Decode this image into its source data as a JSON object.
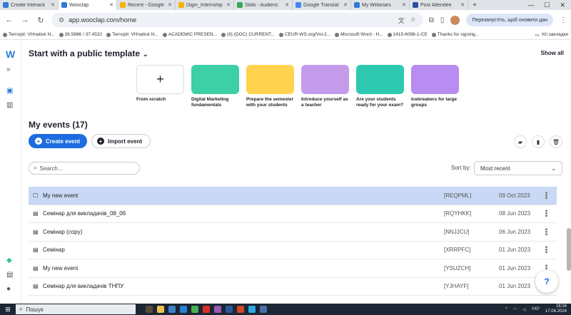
{
  "browser": {
    "tabs": [
      {
        "title": "Create Interacti",
        "color": "#2f7bd9",
        "active": false
      },
      {
        "title": "Wooclap",
        "color": "#2f7bd9",
        "active": true
      },
      {
        "title": "Recent - Google",
        "color": "#f4b400",
        "active": false
      },
      {
        "title": "Digin_Internship",
        "color": "#f4b400",
        "active": false
      },
      {
        "title": "Slido - Audienc",
        "color": "#34a853",
        "active": false
      },
      {
        "title": "Google Translat",
        "color": "#4285f4",
        "active": false
      },
      {
        "title": "My Webinars",
        "color": "#2f7bd9",
        "active": false
      },
      {
        "title": "Post Attendee",
        "color": "#2b4f9e",
        "active": false
      }
    ],
    "url": "app.wooclap.com/home",
    "relaunch_label": "Перезапустіть, щоб оновити дан",
    "bookmarks": [
      "Ternopil: VHnatiuk N...",
      "36.5686 / 37.4532",
      "Ternopil: VHnatiuk N...",
      "ACADEMIC PRESEN...",
      "(6) (DOC) CURRENT...",
      "CEUR-WS.org/Vol-2...",
      "Microsoft Word - H...",
      "1415-6098-1-CE",
      "Thanks for signing..."
    ],
    "all_bookmarks_label": "Усі закладки"
  },
  "templates": {
    "heading": "Start with a public template",
    "show_all": "Show all",
    "items": [
      {
        "caption": "From scratch",
        "style": "scratch"
      },
      {
        "caption": "Digital Marketing fundamentals",
        "style": "mint"
      },
      {
        "caption": "Prepare the semester with your students",
        "style": "yellow"
      },
      {
        "caption": "Introduce yourself as a teacher",
        "style": "lilac"
      },
      {
        "caption": "Are your students ready for your exam?",
        "style": "teal"
      },
      {
        "caption": "Icebreakers for large groups",
        "style": "violet"
      }
    ]
  },
  "events": {
    "heading": "My events (17)",
    "create_label": "Create event",
    "import_label": "Import event",
    "search_placeholder": "Search...",
    "sort_label": "Sort by:",
    "sort_value": "Most recent",
    "rows": [
      {
        "name": "My new event",
        "code": "[REQPML]",
        "date": "09 Oct 2023",
        "selected": true
      },
      {
        "name": "Семінар для викладачів_08_06",
        "code": "[RQYHKK]",
        "date": "08 Jun 2023",
        "selected": false
      },
      {
        "name": "Семінар (copy)",
        "code": "[NNJJCU]",
        "date": "06 Jun 2023",
        "selected": false
      },
      {
        "name": "Семінар",
        "code": "[XRRPFC]",
        "date": "01 Jun 2023",
        "selected": false
      },
      {
        "name": "My new event",
        "code": "[YSUZCH]",
        "date": "01 Jun 2023",
        "selected": false
      },
      {
        "name": "Семінар для викладачів ТНПУ",
        "code": "[YJHAYF]",
        "date": "01 Jun 2023",
        "selected": false
      }
    ]
  },
  "taskbar": {
    "search_label": "Пошук",
    "lang": "УКР",
    "time": "16:16",
    "date": "17.04.2024"
  }
}
